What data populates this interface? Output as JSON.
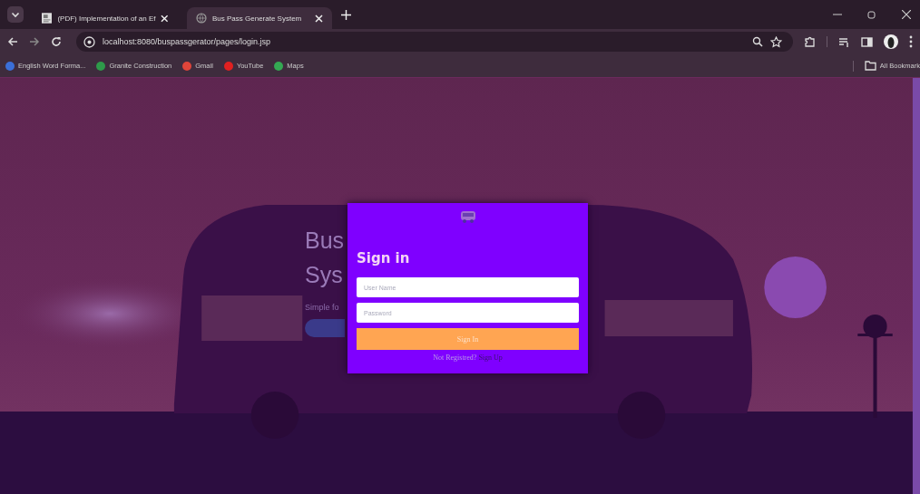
{
  "browser": {
    "tabs": [
      {
        "title": "(PDF) Implementation of an Ef",
        "selected": false
      },
      {
        "title": "Bus Pass Generate System",
        "selected": true
      }
    ],
    "url": "localhost:8080/buspassgerator/pages/login.jsp",
    "bookmarks": [
      {
        "label": "English Word Forma...",
        "color": "#3b6fd8"
      },
      {
        "label": "Granite Construction",
        "color": "#2e9a4a"
      },
      {
        "label": "Gmail",
        "color": "#e0453a"
      },
      {
        "label": "YouTube",
        "color": "#e02020"
      },
      {
        "label": "Maps",
        "color": "#34a853"
      }
    ],
    "all_bookmarks": "All Bookmark"
  },
  "hero": {
    "heading": [
      "Bus",
      "Sys"
    ],
    "tagline": "Simple fo"
  },
  "login": {
    "title": "Sign in",
    "fields": [
      {
        "placeholder": "User Name"
      },
      {
        "placeholder": "Password"
      }
    ],
    "button": "Sign In",
    "prompt": "Not Registred?",
    "link": "Sign Up"
  }
}
